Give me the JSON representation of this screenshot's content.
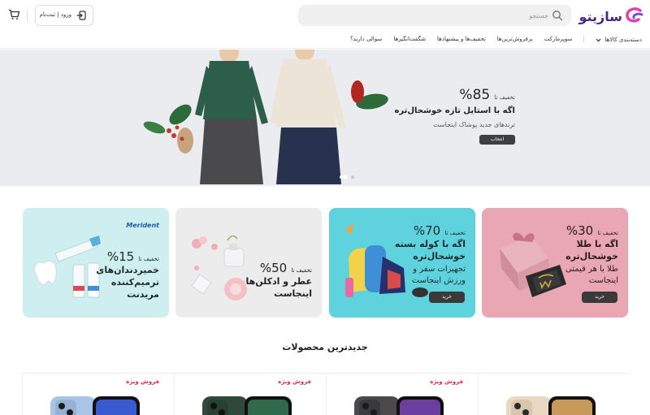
{
  "header": {
    "logo_text": "سازیتو",
    "search_placeholder": "جستجو",
    "login_label": "ورود | ثبت‌نام",
    "nav": [
      {
        "label": "دسته‌بندی کالاها",
        "has_chevron": true
      },
      {
        "label": "سوپرمارکت"
      },
      {
        "label": "پرفروش‌ترین‌ها"
      },
      {
        "label": "تخفیف‌ها و پیشنهادها"
      },
      {
        "label": "شگفت‌انگیزها"
      },
      {
        "label": "سوالی دارید؟"
      }
    ]
  },
  "hero": {
    "discount_label": "تخفیف تا",
    "discount_value": "85%",
    "title": "اگه با استایل تازه خوشحال‌تره",
    "subtitle": "ترندهای جدید پوشاک اینجاست",
    "button": "انتخاب",
    "slides": 2,
    "active_slide": 1
  },
  "cards": [
    {
      "discount_label": "تخفیف تا",
      "discount_value": "30%",
      "title": [
        "اگه با طلا",
        "خوشحال‌تره"
      ],
      "subtitle": [
        "طلا با هر قیمتی",
        "اینجاست"
      ],
      "button": "خرید",
      "bg": "#e8a7b2"
    },
    {
      "discount_label": "تخفیف تا",
      "discount_value": "70%",
      "title": [
        "اگه با کوله بسته",
        "خوشحال‌تره"
      ],
      "subtitle": [
        "تجهیزات سفر و",
        "ورزش اینجاست"
      ],
      "button": "خرید",
      "bg": "#5ed3de"
    },
    {
      "discount_label": "تخفیف تا",
      "discount_value": "50%",
      "title": [
        "عطر و ادکلن‌ها",
        "اینجاست"
      ],
      "subtitle": [],
      "button": "",
      "bg": "#ececec"
    },
    {
      "discount_label": "تخفیف تا",
      "discount_value": "15%",
      "title": [
        "خمیردندان‌های",
        "ترمیم‌کننده",
        "مریدنت"
      ],
      "subtitle": [],
      "button": "",
      "bg": "#cfeef0",
      "brand": "Merident"
    }
  ],
  "section_title": "جدیدترین محصولات",
  "products": [
    {
      "badge": "",
      "color": "#e9d9c4"
    },
    {
      "badge": "فروش ویژه",
      "color": "#4a4a4c"
    },
    {
      "badge": "فروش ویژه",
      "color": "#2f4a3a"
    },
    {
      "badge": "فروش ویژه",
      "color": "#a9c4e4"
    }
  ]
}
